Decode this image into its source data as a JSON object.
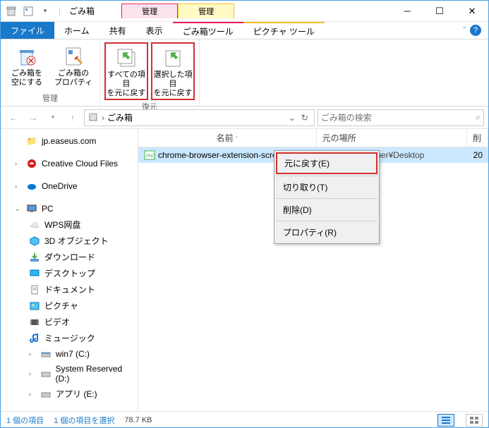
{
  "title": "ごみ箱",
  "contextual_tabs": [
    {
      "heading": "管理",
      "label": "ごみ箱ツール"
    },
    {
      "heading": "管理",
      "label": "ピクチャ ツール"
    }
  ],
  "ribbon_tabs": {
    "file": "ファイル",
    "home": "ホーム",
    "share": "共有",
    "view": "表示"
  },
  "ribbon": {
    "manage_group": "管理",
    "restore_group": "復元",
    "empty_bin": "ごみ箱を\n空にする",
    "bin_props": "ごみ箱の\nプロパティ",
    "restore_all": "すべての項目\nを元に戻す",
    "restore_sel": "選択した項目\nを元に戻す"
  },
  "nav": {
    "address": "ごみ箱",
    "search_placeholder": "ごみ箱の検索"
  },
  "tree": {
    "quick": "jp.easeus.com",
    "ccf": "Creative Cloud Files",
    "onedrive": "OneDrive",
    "pc": "PC",
    "wps": "WPS网盘",
    "obj3d": "3D オブジェクト",
    "downloads": "ダウンロード",
    "desktop": "デスクトップ",
    "documents": "ドキュメント",
    "pictures": "ピクチャ",
    "videos": "ビデオ",
    "music": "ミュージック",
    "win7": "win7 (C:)",
    "sysres": "System Reserved (D:)",
    "apps": "アプリ (E:)"
  },
  "columns": {
    "name": "名前",
    "loc": "元の場所",
    "del": "削"
  },
  "items": [
    {
      "name": "chrome-browser-extension-screen",
      "loc": "C:¥Users¥Owner¥Desktop",
      "del": "20"
    }
  ],
  "context_menu": {
    "restore": "元に戻す(E)",
    "cut": "切り取り(T)",
    "delete": "削除(D)",
    "properties": "プロパティ(R)"
  },
  "status": {
    "count": "1 個の項目",
    "selected": "1 個の項目を選択",
    "size": "78.7 KB"
  }
}
